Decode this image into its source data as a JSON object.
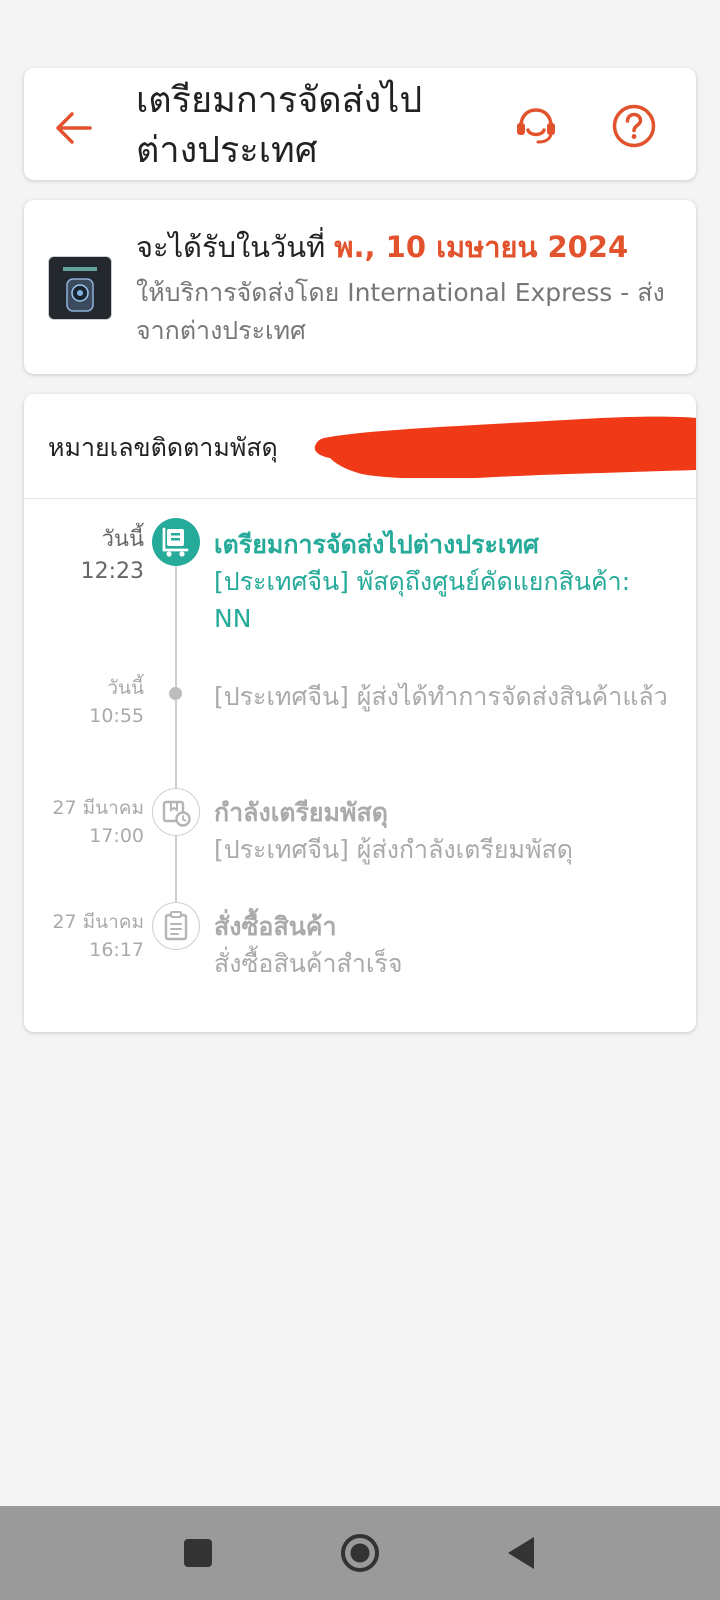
{
  "header": {
    "title": "เตรียมการจัดส่งไปต่างประเทศ",
    "back_icon": "arrow-left-icon",
    "support_icon": "headset-icon",
    "help_icon": "question-circle-icon",
    "accent_color": "#e2532d"
  },
  "delivery": {
    "eta_prefix": "จะได้รับในวันที่",
    "eta_date": "พ., 10 เมษายน 2024",
    "carrier_text": "ให้บริการจัดส่งโดย International Express - ส่งจากต่างประเทศ"
  },
  "tracking": {
    "label": "หมายเลขติดตามพัสดุ",
    "events": [
      {
        "date": "วันนี้",
        "time": "12:23",
        "title": "เตรียมการจัดส่งไปต่างประเทศ",
        "description": "[ประเทศจีน] พัสดุถึงศูนย์คัดแยกสินค้า: NN",
        "icon": "truck-icon",
        "active": true
      },
      {
        "date": "วันนี้",
        "time": "10:55",
        "title": "",
        "description": "[ประเทศจีน] ผู้ส่งได้ทำการจัดส่งสินค้าแล้ว",
        "icon": "dot-icon",
        "active": false
      },
      {
        "date": "27 มีนาคม",
        "time": "17:00",
        "title": "กำลังเตรียมพัสดุ",
        "description": "[ประเทศจีน] ผู้ส่งกำลังเตรียมพัสดุ",
        "icon": "package-clock-icon",
        "active": false
      },
      {
        "date": "27 มีนาคม",
        "time": "16:17",
        "title": "สั่งซื้อสินค้า",
        "description": "สั่งซื้อสินค้าสำเร็จ",
        "icon": "clipboard-icon",
        "active": false
      }
    ],
    "active_color": "#26aa99",
    "redaction_color": "#f03a17"
  },
  "navbar": {
    "buttons": [
      "recents-square-icon",
      "home-circle-icon",
      "back-triangle-icon"
    ]
  }
}
